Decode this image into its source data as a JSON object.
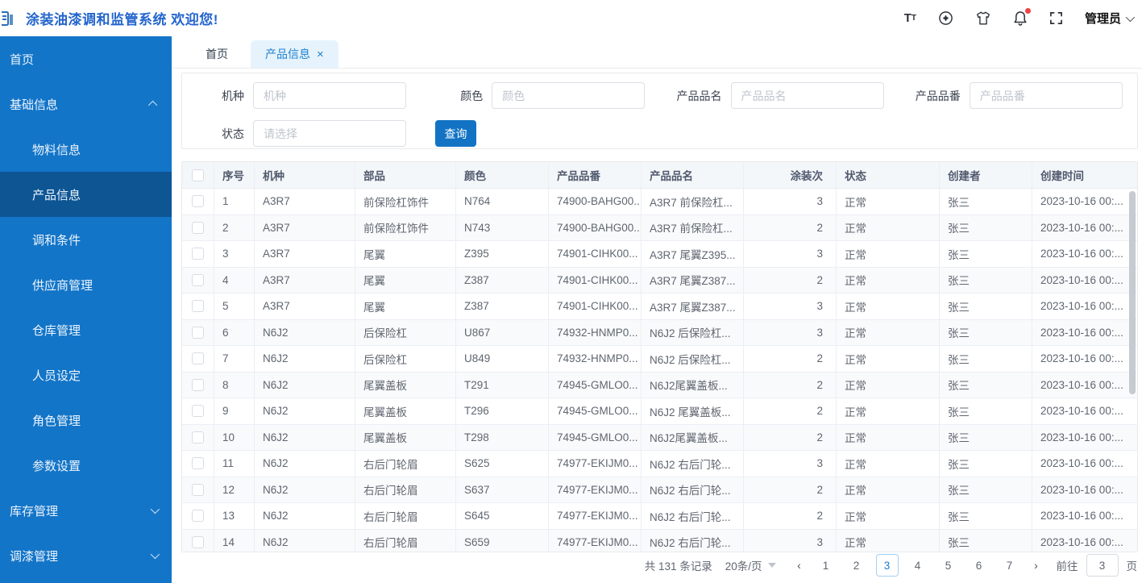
{
  "colors": {
    "accent": "#1273c4",
    "sidebar": "#1375c8",
    "sidebar_active": "#0e5594",
    "title_blue": "#2365cd",
    "tab_active_bg": "#e7f3fc",
    "badge_red": "#ef4444"
  },
  "header": {
    "title": "涂装油漆调和监管系统 欢迎您!",
    "user": "管理员"
  },
  "sidebar": {
    "items": [
      {
        "key": "home",
        "label": "首页"
      },
      {
        "key": "base-info",
        "label": "基础信息",
        "expanded": true,
        "children": [
          {
            "key": "material-info",
            "label": "物料信息"
          },
          {
            "key": "product-info",
            "label": "产品信息",
            "active": true
          },
          {
            "key": "blend-condition",
            "label": "调和条件"
          },
          {
            "key": "supplier-mgmt",
            "label": "供应商管理"
          },
          {
            "key": "warehouse-mgmt",
            "label": "仓库管理"
          },
          {
            "key": "personnel-setting",
            "label": "人员设定"
          },
          {
            "key": "role-mgmt",
            "label": "角色管理"
          },
          {
            "key": "param-setting",
            "label": "参数设置"
          }
        ]
      },
      {
        "key": "inventory-mgmt",
        "label": "库存管理",
        "expanded": false
      },
      {
        "key": "paint-mgmt",
        "label": "调漆管理",
        "expanded": false
      }
    ]
  },
  "tabs": [
    {
      "key": "home",
      "label": "首页",
      "active": false,
      "closable": false
    },
    {
      "key": "product-info",
      "label": "产品信息",
      "active": true,
      "closable": true
    }
  ],
  "search": {
    "fields": [
      {
        "key": "model",
        "label": "机种",
        "placeholder": "机种",
        "row": 1
      },
      {
        "key": "color",
        "label": "颜色",
        "placeholder": "颜色",
        "row": 1
      },
      {
        "key": "product-name",
        "label": "产品品名",
        "placeholder": "产品品名",
        "row": 1
      },
      {
        "key": "product-no",
        "label": "产品品番",
        "placeholder": "产品品番",
        "row": 1
      },
      {
        "key": "status",
        "label": "状态",
        "placeholder": "请选择",
        "row": 2,
        "type": "select"
      }
    ],
    "submit_label": "查询"
  },
  "table": {
    "columns": [
      "序号",
      "机种",
      "部品",
      "颜色",
      "产品品番",
      "产品品名",
      "涂装次",
      "状态",
      "创建者",
      "创建时间"
    ],
    "rows": [
      {
        "index": "1",
        "model": "A3R7",
        "part": "前保险杠饰件",
        "color": "N764",
        "part_no": "74900-BAHG00...",
        "name": "A3R7 前保险杠...",
        "coats": "3",
        "status": "正常",
        "creator": "张三",
        "created": "2023-10-16 00:..."
      },
      {
        "index": "2",
        "model": "A3R7",
        "part": "前保险杠饰件",
        "color": "N743",
        "part_no": "74900-BAHG00...",
        "name": "A3R7 前保险杠...",
        "coats": "2",
        "status": "正常",
        "creator": "张三",
        "created": "2023-10-16 00:..."
      },
      {
        "index": "3",
        "model": "A3R7",
        "part": "尾翼",
        "color": "Z395",
        "part_no": "74901-CIHK00...",
        "name": "A3R7 尾翼Z395...",
        "coats": "3",
        "status": "正常",
        "creator": "张三",
        "created": "2023-10-16 00:..."
      },
      {
        "index": "4",
        "model": "A3R7",
        "part": "尾翼",
        "color": "Z387",
        "part_no": "74901-CIHK00...",
        "name": "A3R7 尾翼Z387...",
        "coats": "2",
        "status": "正常",
        "creator": "张三",
        "created": "2023-10-16 00:..."
      },
      {
        "index": "5",
        "model": "A3R7",
        "part": "尾翼",
        "color": "Z387",
        "part_no": "74901-CIHK00...",
        "name": "A3R7 尾翼Z387...",
        "coats": "3",
        "status": "正常",
        "creator": "张三",
        "created": "2023-10-16 00:..."
      },
      {
        "index": "6",
        "model": "N6J2",
        "part": "后保险杠",
        "color": "U867",
        "part_no": "74932-HNMP0...",
        "name": "N6J2 后保险杠...",
        "coats": "3",
        "status": "正常",
        "creator": "张三",
        "created": "2023-10-16 00:..."
      },
      {
        "index": "7",
        "model": "N6J2",
        "part": "后保险杠",
        "color": "U849",
        "part_no": "74932-HNMP0...",
        "name": "N6J2 后保险杠...",
        "coats": "2",
        "status": "正常",
        "creator": "张三",
        "created": "2023-10-16 00:..."
      },
      {
        "index": "8",
        "model": "N6J2",
        "part": "尾翼盖板",
        "color": "T291",
        "part_no": "74945-GMLO0...",
        "name": "N6J2尾翼盖板...",
        "coats": "2",
        "status": "正常",
        "creator": "张三",
        "created": "2023-10-16 00:..."
      },
      {
        "index": "9",
        "model": "N6J2",
        "part": "尾翼盖板",
        "color": "T296",
        "part_no": "74945-GMLO0...",
        "name": "N6J2 尾翼盖板...",
        "coats": "2",
        "status": "正常",
        "creator": "张三",
        "created": "2023-10-16 00:..."
      },
      {
        "index": "10",
        "model": "N6J2",
        "part": "尾翼盖板",
        "color": "T298",
        "part_no": "74945-GMLO0...",
        "name": "N6J2尾翼盖板...",
        "coats": "2",
        "status": "正常",
        "creator": "张三",
        "created": "2023-10-16 00:..."
      },
      {
        "index": "11",
        "model": "N6J2",
        "part": "右后门轮眉",
        "color": "S625",
        "part_no": "74977-EKIJM0...",
        "name": "N6J2 右后门轮...",
        "coats": "3",
        "status": "正常",
        "creator": "张三",
        "created": "2023-10-16 00:..."
      },
      {
        "index": "12",
        "model": "N6J2",
        "part": "右后门轮眉",
        "color": "S637",
        "part_no": "74977-EKIJM0...",
        "name": "N6J2 右后门轮...",
        "coats": "2",
        "status": "正常",
        "creator": "张三",
        "created": "2023-10-16 00:..."
      },
      {
        "index": "13",
        "model": "N6J2",
        "part": "右后门轮眉",
        "color": "S645",
        "part_no": "74977-EKIJM0...",
        "name": "N6J2 右后门轮...",
        "coats": "2",
        "status": "正常",
        "creator": "张三",
        "created": "2023-10-16 00:..."
      },
      {
        "index": "14",
        "model": "N6J2",
        "part": "右后门轮眉",
        "color": "S659",
        "part_no": "74977-EKIJM0...",
        "name": "N6J2 右后门轮...",
        "coats": "3",
        "status": "正常",
        "creator": "张三",
        "created": "2023-10-16 00:..."
      }
    ]
  },
  "pagination": {
    "total_text": "共 131 条记录",
    "page_size_label": "20条/页",
    "pages": [
      "1",
      "2",
      "3",
      "4",
      "5",
      "6",
      "7"
    ],
    "current_page": "3",
    "prev_label": "‹",
    "next_label": "›",
    "goto_label": "前往",
    "goto_value": "3",
    "goto_suffix": "页"
  }
}
